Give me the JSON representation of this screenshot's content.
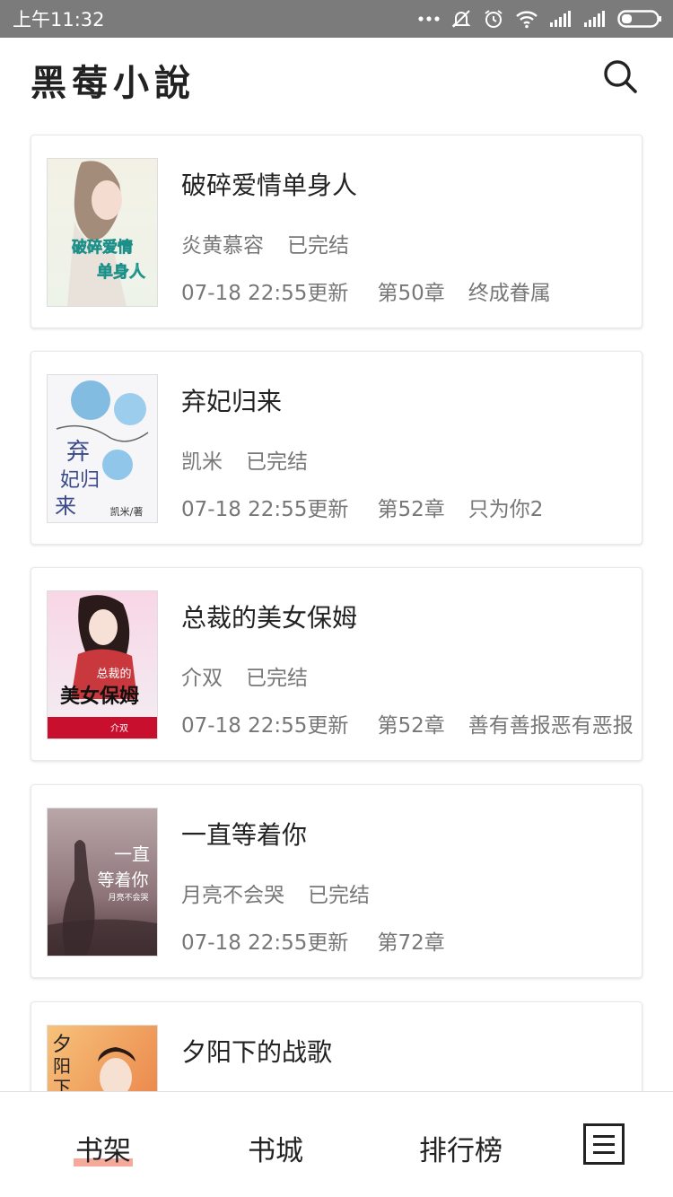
{
  "status_bar": {
    "time": "上午11:32"
  },
  "header": {
    "title": "黑莓小說"
  },
  "books": [
    {
      "title": "破碎爱情单身人",
      "author": "炎黄慕容",
      "status": "已完结",
      "updated": "07-18 22:55更新",
      "chapter": "第50章",
      "chapter_title": "终成眷属",
      "cover_text": [
        "破碎爱情",
        "单身人"
      ]
    },
    {
      "title": "弃妃归来",
      "author": "凯米",
      "status": "已完结",
      "updated": "07-18 22:55更新",
      "chapter": "第52章",
      "chapter_title": "只为你2",
      "cover_text": [
        "弃",
        "妃归",
        "来",
        "凯米/著"
      ]
    },
    {
      "title": "总裁的美女保姆",
      "author": "介双",
      "status": "已完结",
      "updated": "07-18 22:55更新",
      "chapter": "第52章",
      "chapter_title": "善有善报恶有恶报",
      "cover_text": [
        "总裁的",
        "美女保姆",
        "介双"
      ]
    },
    {
      "title": "一直等着你",
      "author": "月亮不会哭",
      "status": "已完结",
      "updated": "07-18 22:55更新",
      "chapter": "第72章",
      "chapter_title": "",
      "cover_text": [
        "一直",
        "等着你",
        "月亮不会哭"
      ]
    },
    {
      "title": "夕阳下的战歌",
      "author": "",
      "status": "",
      "updated": "",
      "chapter": "",
      "chapter_title": "",
      "cover_text": [
        "夕",
        "阳",
        "下"
      ]
    }
  ],
  "nav": {
    "shelf": "书架",
    "store": "书城",
    "rank": "排行榜"
  },
  "colors": {
    "status_bar": "#7b7b7b",
    "active_underline": "#f5a99b",
    "meta_text": "#777777"
  }
}
